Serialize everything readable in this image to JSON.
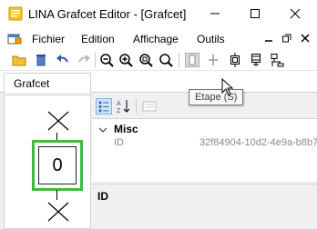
{
  "window": {
    "title": "LINA Grafcet Editor - [Grafcet]"
  },
  "menu": {
    "items": [
      {
        "label": "Fichier"
      },
      {
        "label": "Edition"
      },
      {
        "label": "Affichage"
      },
      {
        "label": "Outils"
      }
    ]
  },
  "toolbar": {
    "buttons": [
      {
        "icon": "open-folder-icon"
      },
      {
        "icon": "trash-icon"
      },
      {
        "icon": "undo-icon"
      },
      {
        "icon": "redo-icon"
      },
      {
        "icon": "zoom-out-icon"
      },
      {
        "icon": "zoom-in-icon"
      },
      {
        "icon": "zoom-fit-icon"
      },
      {
        "icon": "zoom-reset-icon"
      },
      {
        "icon": "step-tool-icon"
      },
      {
        "icon": "transition-tool-icon"
      },
      {
        "icon": "initial-step-icon"
      },
      {
        "icon": "macro-step-icon"
      },
      {
        "icon": "divergence-icon"
      }
    ],
    "tooltip": "Etape (S)"
  },
  "document": {
    "tab_label": "Grafcet",
    "step_number": "0",
    "selection_color": "#3fb93f"
  },
  "property_grid": {
    "category": "Misc",
    "properties": [
      {
        "name": "ID",
        "value": "32f84904-10d2-4e9a-b8b7"
      }
    ],
    "description_title": "ID"
  }
}
